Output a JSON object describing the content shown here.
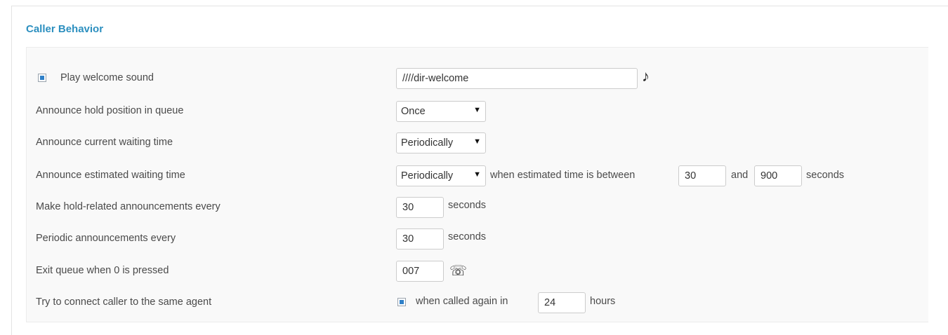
{
  "section": {
    "title": "Caller Behavior"
  },
  "rows": {
    "welcome": {
      "label": "Play welcome sound",
      "checked": true,
      "sound_value": "////dir-welcome",
      "icon": "music-note-icon"
    },
    "hold_position": {
      "label": "Announce hold position in queue",
      "selected": "Once"
    },
    "current_wait": {
      "label": "Announce current waiting time",
      "selected": "Periodically"
    },
    "estimated_wait": {
      "label": "Announce estimated waiting time",
      "selected": "Periodically",
      "text_between": "when estimated time is between",
      "min": "30",
      "text_and": "and",
      "max": "900",
      "unit": "seconds"
    },
    "hold_interval": {
      "label": "Make hold-related announcements every",
      "value": "30",
      "unit": "seconds"
    },
    "periodic_interval": {
      "label": "Periodic announcements every",
      "value": "30",
      "unit": "seconds"
    },
    "exit_queue": {
      "label": "Exit queue when 0 is pressed",
      "value": "007",
      "icon": "telephone-icon"
    },
    "same_agent": {
      "label": "Try to connect caller to the same agent",
      "checked": true,
      "text_when": "when called again in",
      "value": "24",
      "unit": "hours"
    }
  },
  "colors": {
    "accent": "#2c8fbf",
    "checkbox": "#2f80c8",
    "panel": "#f9f9f9"
  }
}
